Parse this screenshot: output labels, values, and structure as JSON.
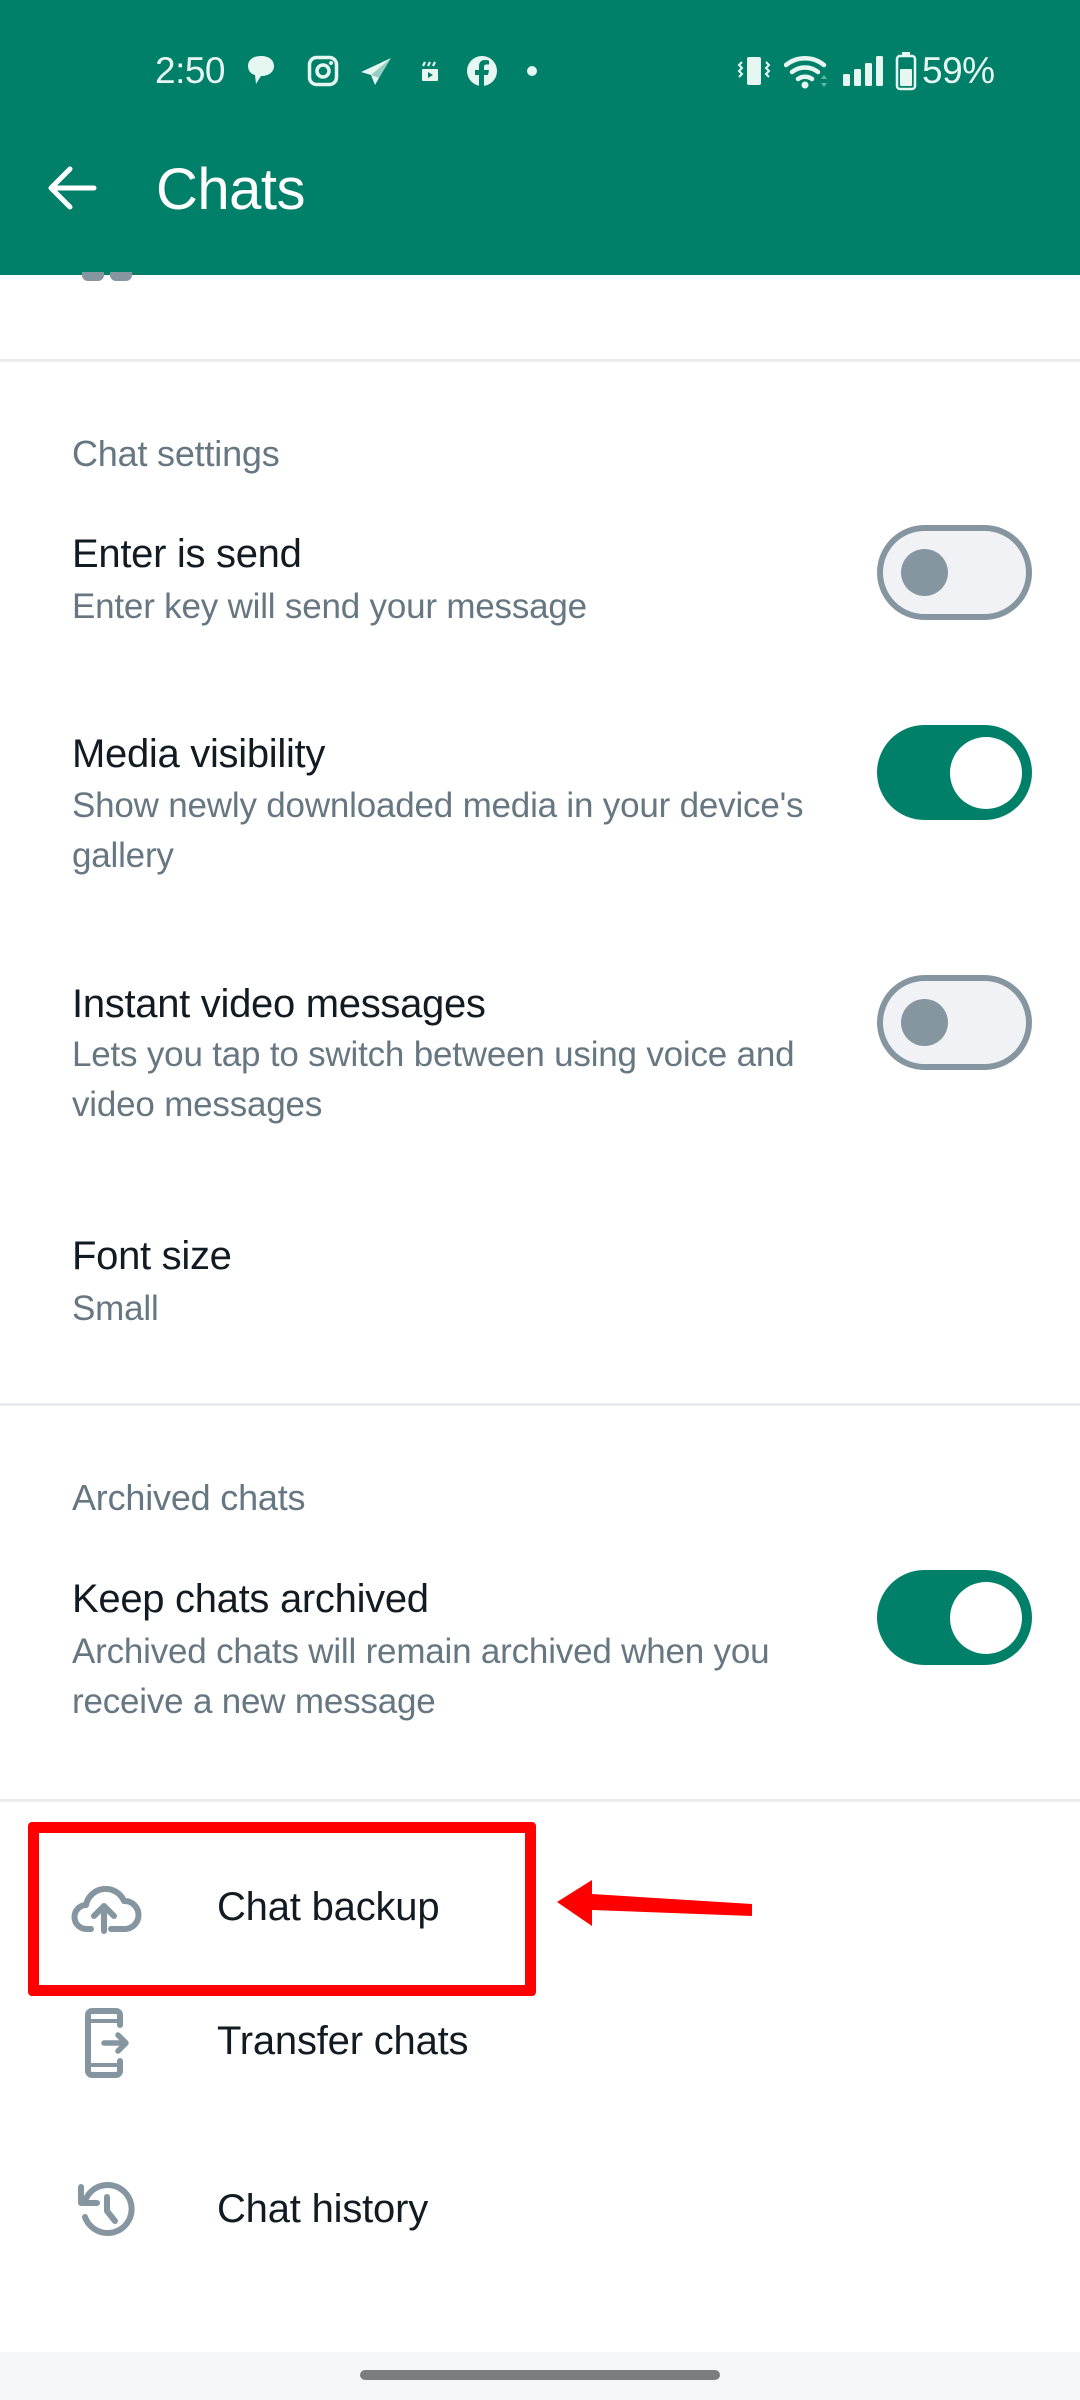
{
  "status_bar": {
    "time": "2:50",
    "notification_icons": [
      "messages-icon",
      "instagram-icon",
      "telegram-icon",
      "clapperboard-icon",
      "facebook-icon",
      "more-dot-icon"
    ],
    "system_icons": [
      "vibrate-icon",
      "wifi-icon",
      "signal-icon",
      "battery-icon"
    ],
    "battery_percent": "59%"
  },
  "header": {
    "back_icon": "arrow-back-icon",
    "title": "Chats"
  },
  "sections": {
    "chat_settings": {
      "title": "Chat settings",
      "items": [
        {
          "label": "Enter is send",
          "description": "Enter key will send your message",
          "toggle": false
        },
        {
          "label": "Media visibility",
          "description": "Show newly downloaded media in your device's gallery",
          "toggle": true
        },
        {
          "label": "Instant video messages",
          "description": "Lets you tap to switch between using voice and video messages",
          "toggle": false
        },
        {
          "label": "Font size",
          "description": "Small"
        }
      ]
    },
    "archived_chats": {
      "title": "Archived chats",
      "items": [
        {
          "label": "Keep chats archived",
          "description": "Archived chats will remain archived when you receive a new message",
          "toggle": true
        }
      ]
    },
    "actions": [
      {
        "label": "Chat backup",
        "icon": "cloud-upload-icon"
      },
      {
        "label": "Transfer chats",
        "icon": "phone-transfer-icon"
      },
      {
        "label": "Chat history",
        "icon": "history-icon"
      }
    ]
  },
  "annotation": {
    "highlighted_item": "Chat backup",
    "color": "#ff0000"
  },
  "colors": {
    "brand": "#008069",
    "primary_text": "#111b21",
    "secondary_text": "#667781",
    "icon_gray": "#8696a0",
    "divider": "#e9edef"
  }
}
